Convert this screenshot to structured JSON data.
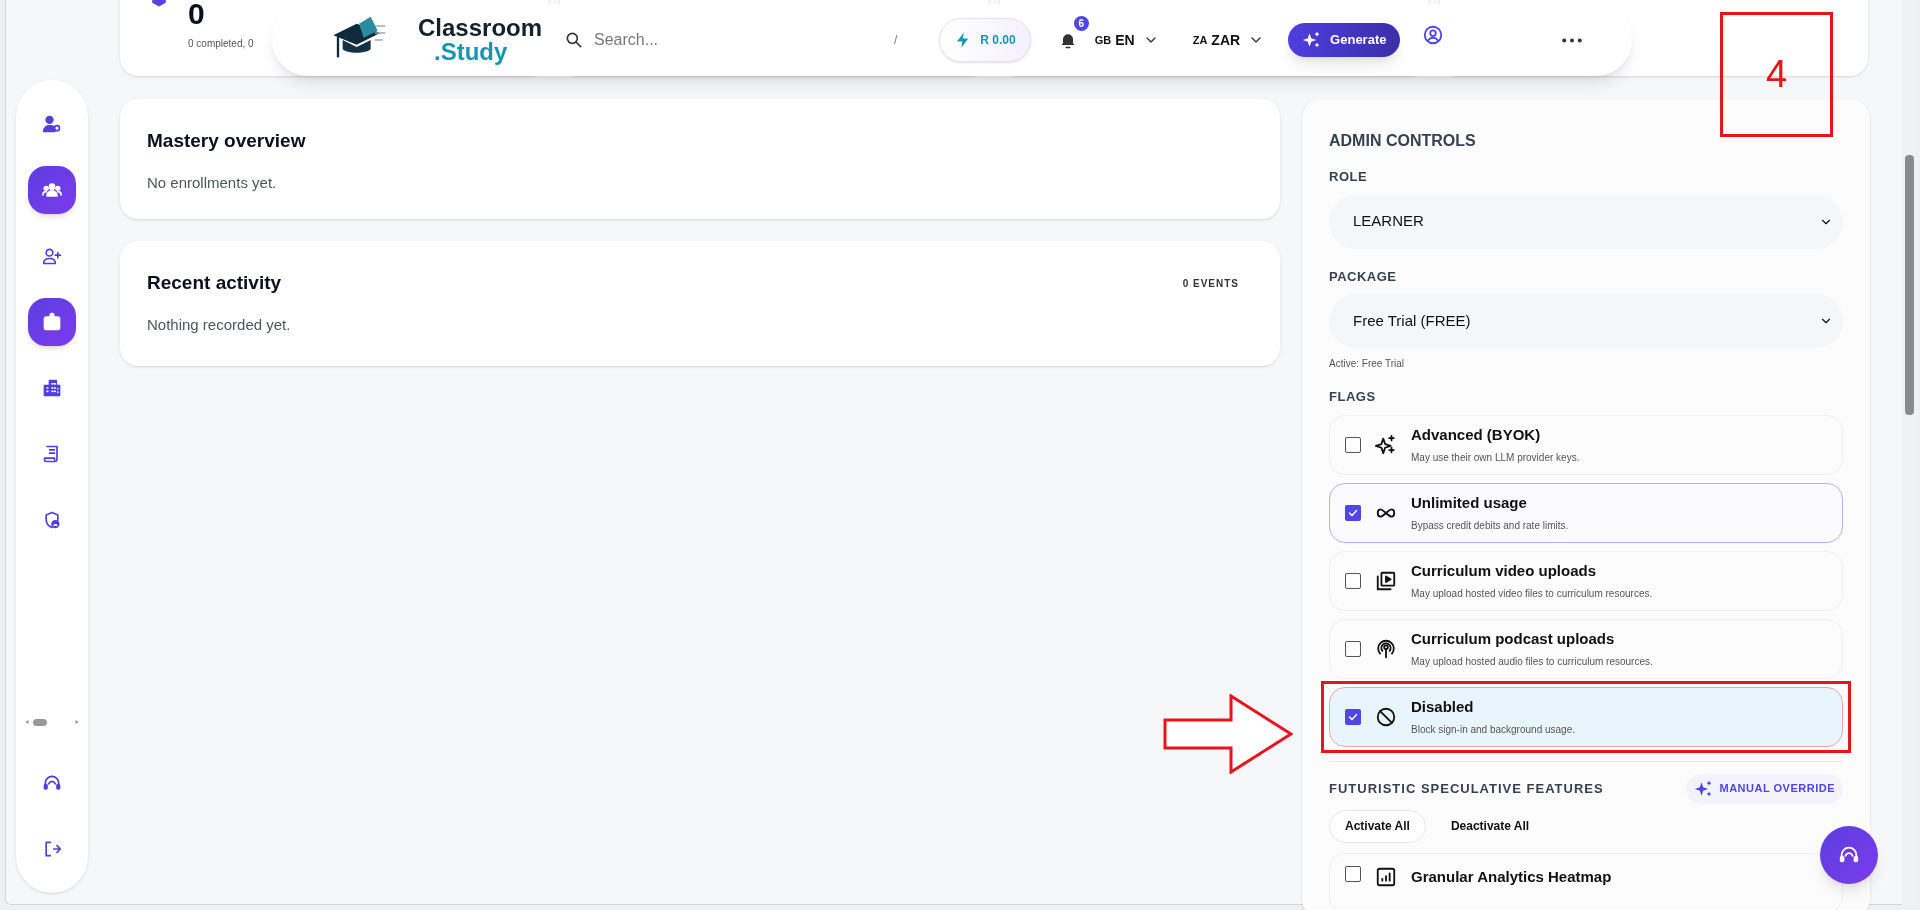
{
  "stats": [
    {
      "value": "0",
      "caption": "0 completed, 0"
    }
  ],
  "header": {
    "logo": {
      "line_1": "Classroom",
      "line_2": ".Study"
    },
    "search": {
      "placeholder": "Search..."
    },
    "shortcut": "/",
    "credits": "R 0.00",
    "notifications": {
      "count": "6"
    },
    "language": {
      "code": "GB",
      "label": "EN"
    },
    "currency": {
      "code": "ZA",
      "label": "ZAR"
    },
    "generate_button": "Generate"
  },
  "sidebar": {
    "items": [
      {
        "selected": false
      },
      {
        "selected": true
      },
      {
        "selected": false
      },
      {
        "selected": true
      },
      {
        "selected": false
      },
      {
        "selected": false
      },
      {
        "selected": false
      }
    ]
  },
  "mastery": {
    "title": "Mastery overview",
    "text": "No enrollments yet."
  },
  "activity": {
    "title": "Recent activity",
    "count": "0 EVENTS",
    "text": "Nothing recorded yet."
  },
  "admin": {
    "title": "ADMIN CONTROLS",
    "role": {
      "label": "ROLE",
      "value": "LEARNER"
    },
    "package": {
      "label": "PACKAGE",
      "value": "Free Trial (FREE)",
      "note": "Active: Free Trial"
    },
    "flags_label": "FLAGS",
    "flags": [
      {
        "kind": "feature",
        "title": "Advanced (BYOK)",
        "description": "May use their own LLM provider keys.",
        "checked": false,
        "highlighted": false
      },
      {
        "kind": "feature",
        "title": "Unlimited usage",
        "description": "Bypass credit debits and rate limits.",
        "checked": true,
        "highlighted": false
      },
      {
        "kind": "feature",
        "title": "Curriculum video uploads",
        "description": "May upload hosted video files to curriculum resources.",
        "checked": false,
        "highlighted": false
      },
      {
        "kind": "feature",
        "title": "Curriculum podcast uploads",
        "description": "May upload hosted audio files to curriculum resources.",
        "checked": false,
        "highlighted": false
      },
      {
        "kind": "block",
        "title": "Disabled",
        "description": "Block sign-in and background usage.",
        "checked": true,
        "highlighted": true
      }
    ],
    "features": {
      "title": "FUTURISTIC SPECULATIVE FEATURES",
      "override_button": "MANUAL OVERRIDE",
      "activate_all": "Activate All",
      "deactivate_all": "Deactivate All",
      "items": [
        {
          "title": "Granular Analytics Heatmap",
          "checked": false
        }
      ]
    }
  },
  "annotation": {
    "step_number": "4"
  }
}
